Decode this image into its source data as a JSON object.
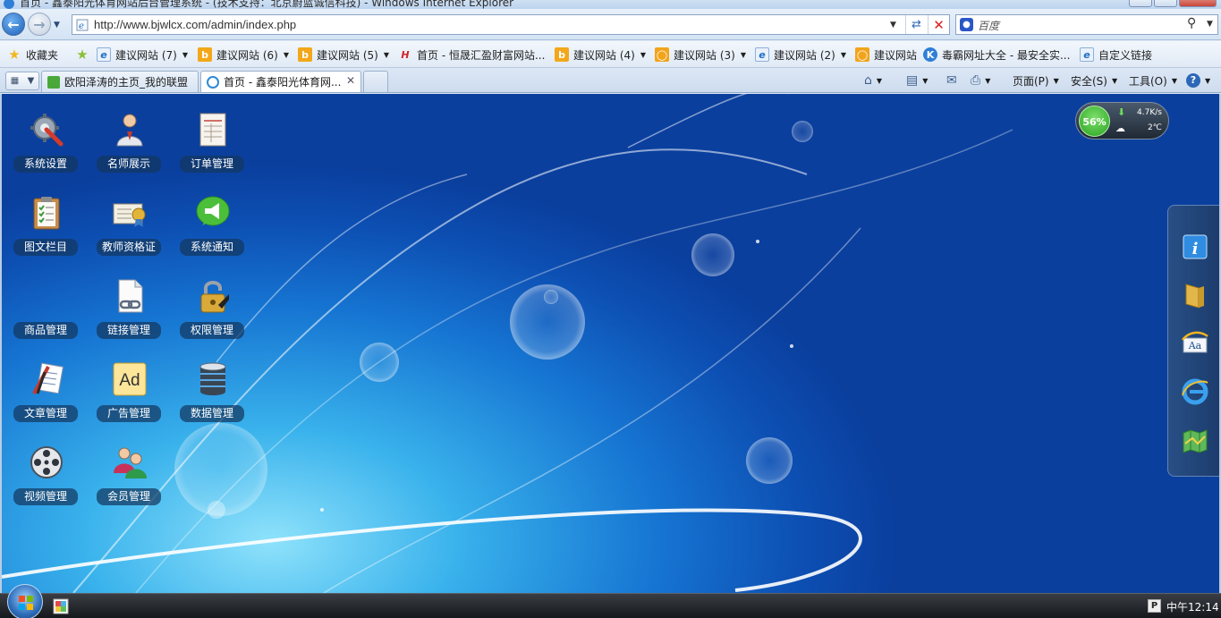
{
  "window": {
    "title": "首页 - 鑫泰阳光体育网站后台管理系统 - (技术支持：北京蔚蓝诚信科技) - Windows Internet Explorer"
  },
  "address_bar": {
    "url": "http://www.bjwlcx.com/admin/index.php",
    "search_placeholder": "百度"
  },
  "favorites": {
    "label": "收藏夹",
    "items": [
      {
        "label": "建议网站 (7)",
        "icon": "ie-icon"
      },
      {
        "label": "建议网站 (6)",
        "icon": "bing-icon"
      },
      {
        "label": "建议网站 (5)",
        "icon": "bing-icon"
      },
      {
        "label": "首页 - 恒晟汇盈财富网站...",
        "icon": "h-logo-icon"
      },
      {
        "label": "建议网站 (4)",
        "icon": "bing-icon"
      },
      {
        "label": "建议网站 (3)",
        "icon": "ring-icon"
      },
      {
        "label": "建议网站 (2)",
        "icon": "ie-icon"
      },
      {
        "label": "建议网站",
        "icon": "ring-icon"
      },
      {
        "label": "毒霸网址大全 - 最安全实...",
        "icon": "k-logo-icon"
      },
      {
        "label": "自定义链接",
        "icon": "ie-icon"
      }
    ]
  },
  "tabs": [
    {
      "label": "欧阳泽涛的主页_我的联盟"
    },
    {
      "label": "首页 - 鑫泰阳光体育网..."
    }
  ],
  "command_bar": {
    "page": "页面(P)",
    "safety": "安全(S)",
    "tools": "工具(O)"
  },
  "desktop_icons": [
    {
      "label": "系统设置",
      "icon": "gear-wrench-icon"
    },
    {
      "label": "名师展示",
      "icon": "teacher-icon"
    },
    {
      "label": "订单管理",
      "icon": "order-sheet-icon"
    },
    {
      "label": "图文栏目",
      "icon": "clipboard-icon"
    },
    {
      "label": "教师资格证",
      "icon": "certificate-icon"
    },
    {
      "label": "系统通知",
      "icon": "megaphone-icon"
    },
    {
      "label": "商品管理",
      "icon": ""
    },
    {
      "label": "链接管理",
      "icon": "link-document-icon"
    },
    {
      "label": "权限管理",
      "icon": "padlock-icon"
    },
    {
      "label": "文章管理",
      "icon": "article-pen-icon"
    },
    {
      "label": "广告管理",
      "icon": "ad-icon"
    },
    {
      "label": "数据管理",
      "icon": "database-icon"
    },
    {
      "label": "视频管理",
      "icon": "film-reel-icon"
    },
    {
      "label": "会员管理",
      "icon": "members-icon"
    }
  ],
  "ad_icon_text": "Ad",
  "gadget": {
    "cpu_percent": "56%",
    "speed": "4.7K/s",
    "temperature": "2℃"
  },
  "taskbar": {
    "clock": "中午12:14"
  },
  "colors": {
    "desktop_blue": "#1675d2",
    "label_bg": "#14375f",
    "accent_green": "#27a21f"
  }
}
